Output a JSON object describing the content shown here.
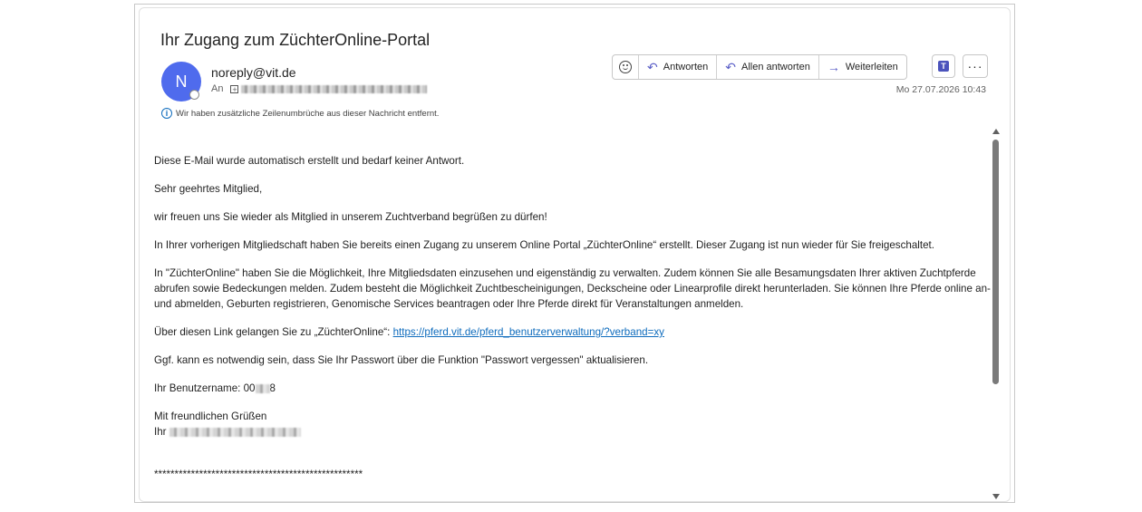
{
  "email": {
    "subject": "Ihr Zugang zum ZüchterOnline-Portal",
    "sender_initial": "N",
    "sender": "noreply@vit.de",
    "to_label": "An",
    "date": "Mo 27.07.2026 10:43",
    "info_notice": "Wir haben zusätzliche Zeilenumbrüche aus dieser Nachricht entfernt."
  },
  "toolbar": {
    "reply": "Antworten",
    "reply_all": "Allen antworten",
    "forward": "Weiterleiten"
  },
  "body": {
    "p1": "Diese E-Mail wurde automatisch erstellt und bedarf keiner Antwort.",
    "p2": "Sehr geehrtes Mitglied,",
    "p3": "wir freuen uns Sie wieder als Mitglied in unserem Zuchtverband begrüßen zu dürfen!",
    "p4": "In Ihrer vorherigen Mitgliedschaft haben Sie bereits einen Zugang zu unserem Online Portal „ZüchterOnline“ erstellt. Dieser Zugang ist nun wieder für Sie freigeschaltet.",
    "p5": "In \"ZüchterOnline\" haben Sie die Möglichkeit, Ihre Mitgliedsdaten einzusehen und eigenständig zu verwalten. Zudem können Sie alle Besamungsdaten Ihrer aktiven Zuchtpferde abrufen sowie Bedeckungen melden. Zudem besteht die Möglichkeit Zuchtbescheinigungen, Deckscheine oder Linearprofile direkt herunterladen. Sie können Ihre Pferde online an- und abmelden, Geburten registrieren, Genomische Services beantragen oder Ihre Pferde direkt für Veranstaltungen anmelden.",
    "p6_prefix": "Über diesen Link gelangen Sie zu „ZüchterOnline“: ",
    "p6_link": "https://pferd.vit.de/pferd_benutzerverwaltung/?verband=xy",
    "p7": "Ggf. kann es notwendig sein, dass Sie Ihr Passwort über die Funktion \"Passwort vergessen\" aktualisieren.",
    "username_prefix": "Ihr Benutzername: 00",
    "username_suffix": "8",
    "closing": "Mit freundlichen Grüßen",
    "signature_prefix": "Ihr",
    "stars": "***************************************************"
  }
}
